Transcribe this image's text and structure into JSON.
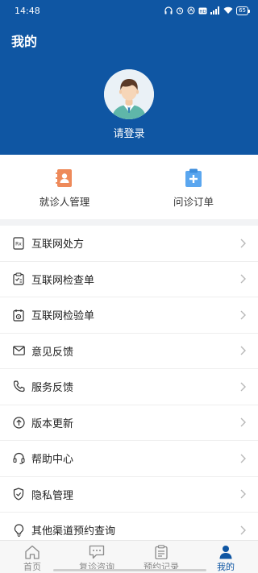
{
  "status": {
    "time": "14:48",
    "battery": "65"
  },
  "header": {
    "title": "我的",
    "login_prompt": "请登录"
  },
  "quick_actions": [
    {
      "label": "就诊人管理",
      "icon": "contacts-icon",
      "color": "#ee8a5a"
    },
    {
      "label": "问诊订单",
      "icon": "clipboard-plus-icon",
      "color": "#5aa6ef"
    }
  ],
  "menu": [
    {
      "label": "互联网处方",
      "icon": "prescription-icon"
    },
    {
      "label": "互联网检查单",
      "icon": "checklist-icon"
    },
    {
      "label": "互联网检验单",
      "icon": "test-report-icon"
    },
    {
      "label": "意见反馈",
      "icon": "mail-icon"
    },
    {
      "label": "服务反馈",
      "icon": "phone-icon"
    },
    {
      "label": "版本更新",
      "icon": "upgrade-icon"
    },
    {
      "label": "帮助中心",
      "icon": "headset-icon"
    },
    {
      "label": "隐私管理",
      "icon": "shield-icon"
    },
    {
      "label": "其他渠道预约查询",
      "icon": "bulb-icon"
    }
  ],
  "tabs": [
    {
      "label": "首页",
      "icon": "home-icon",
      "active": false
    },
    {
      "label": "复诊咨询",
      "icon": "chat-icon",
      "active": false
    },
    {
      "label": "预约记录",
      "icon": "record-icon",
      "active": false
    },
    {
      "label": "我的",
      "icon": "user-icon",
      "active": true
    }
  ],
  "colors": {
    "brand": "#0f56a3",
    "background": "#f2f3f5"
  }
}
